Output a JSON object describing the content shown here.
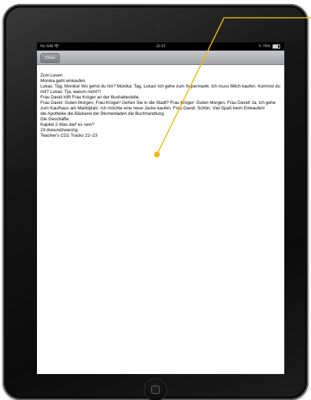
{
  "status_bar": {
    "carrier": "No SIM",
    "wifi_icon": "wifi-icon",
    "time": "12:22",
    "battery_text": "78%",
    "battery_icon": "battery-icon"
  },
  "toolbar": {
    "close_label": "Close"
  },
  "content": {
    "lines": [
      "Zum Lesen",
      "Monika geht einkaufen.",
      "Lukas: Tag, Monika! Wo gehst du hin? Monika: Tag, Lukas! Ich gehe zum Supermarkt. Ich muss Milch kaufen. Kommst du mit? Lukas: Tja, warum nicht?!",
      "Frau David trifft Frau Krüger an der Bushaltestelle.",
      "Frau David: Guten Morgen, Frau Krüger! Gehen Sie in die Stadt? Frau Krüger: Guten Morgen, Frau David! Ja, ich gehe zum Kaufhaus am Marktplatz. Ich möchte eine neue Jacke kaufen. Frau David: Schön. Viel Spaß beim Einkaufen!",
      "die Apotheke die Bäckerei der Blumenladen die Buchhandlung",
      "Die Geschäfte",
      "Kapitel 2 Was darf es sein?",
      "23 dreiundzwanzig",
      "Teacher's CD1 Tracks 22–23"
    ]
  },
  "colors": {
    "callout": "#f5b800",
    "device_bezel": "#111111",
    "toolbar": "#b3b6ba"
  }
}
